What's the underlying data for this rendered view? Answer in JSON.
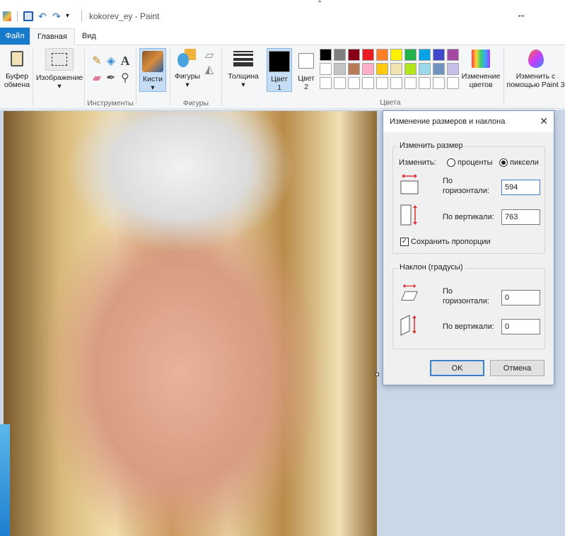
{
  "window": {
    "title": "kokorev_ey - Paint"
  },
  "tabs": [
    {
      "label": "Файл"
    },
    {
      "label": "Главная"
    },
    {
      "label": "Вид"
    }
  ],
  "ribbon": {
    "clipboard": {
      "label_line1": "Буфер",
      "label_line2": "обмена"
    },
    "image": {
      "label": "Изображение"
    },
    "tools": {
      "group_label": "Инструменты"
    },
    "brushes": {
      "label": "Кисти"
    },
    "shapes": {
      "label": "Фигуры",
      "group_label": "Фигуры"
    },
    "thickness": {
      "label": "Толщина"
    },
    "color1": {
      "label_line1": "Цвет",
      "label_line2": "1",
      "value": "#000000"
    },
    "color2": {
      "label_line1": "Цвет",
      "label_line2": "2",
      "value": "#ffffff"
    },
    "colors_group_label": "Цвета",
    "edit_colors": {
      "label_line1": "Изменение",
      "label_line2": "цветов"
    },
    "paint3d": {
      "label_line1": "Изменить с",
      "label_line2": "помощью Paint 3"
    },
    "palette": [
      "#000000",
      "#7f7f7f",
      "#880015",
      "#ed1c24",
      "#ff7f27",
      "#fff200",
      "#22b14c",
      "#00a2e8",
      "#3f48cc",
      "#a349a4",
      "#ffffff",
      "#c3c3c3",
      "#b97a57",
      "#ffaec9",
      "#ffc90e",
      "#efe4b0",
      "#b5e61d",
      "#99d9ea",
      "#7092be",
      "#c8bfe7",
      "#ffffff",
      "#ffffff",
      "#ffffff",
      "#ffffff",
      "#ffffff",
      "#ffffff",
      "#ffffff",
      "#ffffff",
      "#ffffff",
      "#ffffff"
    ]
  },
  "dialog": {
    "title": "Изменение размеров и наклона",
    "close_glyph": "✕",
    "resize": {
      "legend": "Изменить размер",
      "by_label": "Изменить:",
      "option_percent": "проценты",
      "option_pixels": "пиксели",
      "selected": "pixels",
      "horizontal_label_line1": "По",
      "horizontal_label_line2": "горизонтали:",
      "horizontal_value": "594",
      "vertical_label": "По вертикали:",
      "vertical_value": "763",
      "keep_ratio_label": "Сохранить пропорции",
      "keep_ratio_checked": true
    },
    "skew": {
      "legend": "Наклон (градусы)",
      "horizontal_label_line1": "По",
      "horizontal_label_line2": "горизонтали:",
      "horizontal_value": "0",
      "vertical_label": "По вертикали:",
      "vertical_value": "0"
    },
    "ok_label": "OK",
    "cancel_label": "Отмена"
  }
}
